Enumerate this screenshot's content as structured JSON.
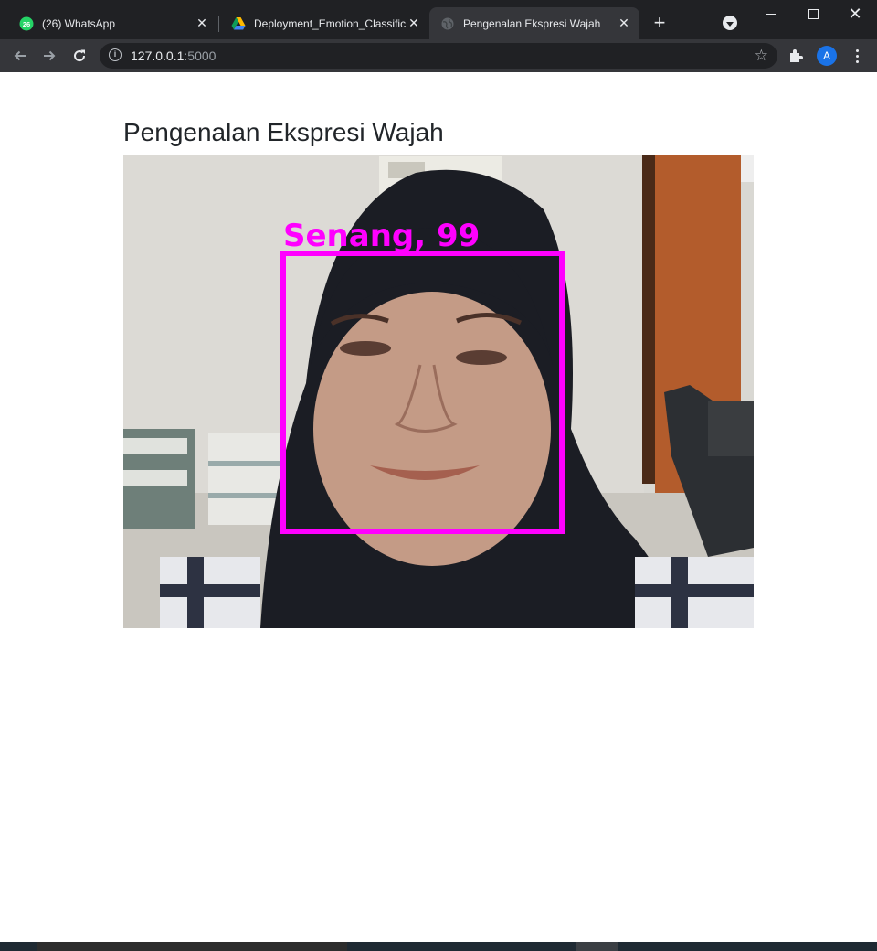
{
  "browser": {
    "tabs": [
      {
        "title": "(26) WhatsApp",
        "badge": "26",
        "icon": "whatsapp-icon",
        "active": false
      },
      {
        "title": "Deployment_Emotion_Classifica",
        "icon": "google-drive-icon",
        "active": false
      },
      {
        "title": "Pengenalan Ekspresi Wajah",
        "icon": "globe-icon",
        "active": true
      }
    ],
    "address": {
      "host": "127.0.0.1",
      "port": ":5000"
    },
    "profile_initial": "A"
  },
  "page": {
    "title": "Pengenalan Ekspresi Wajah",
    "detection": {
      "label": "Senang, 99",
      "box_color": "#ff00ff"
    }
  },
  "colors": {
    "tab_bar": "#202124",
    "toolbar": "#35363a",
    "accent": "#1a73e8"
  }
}
